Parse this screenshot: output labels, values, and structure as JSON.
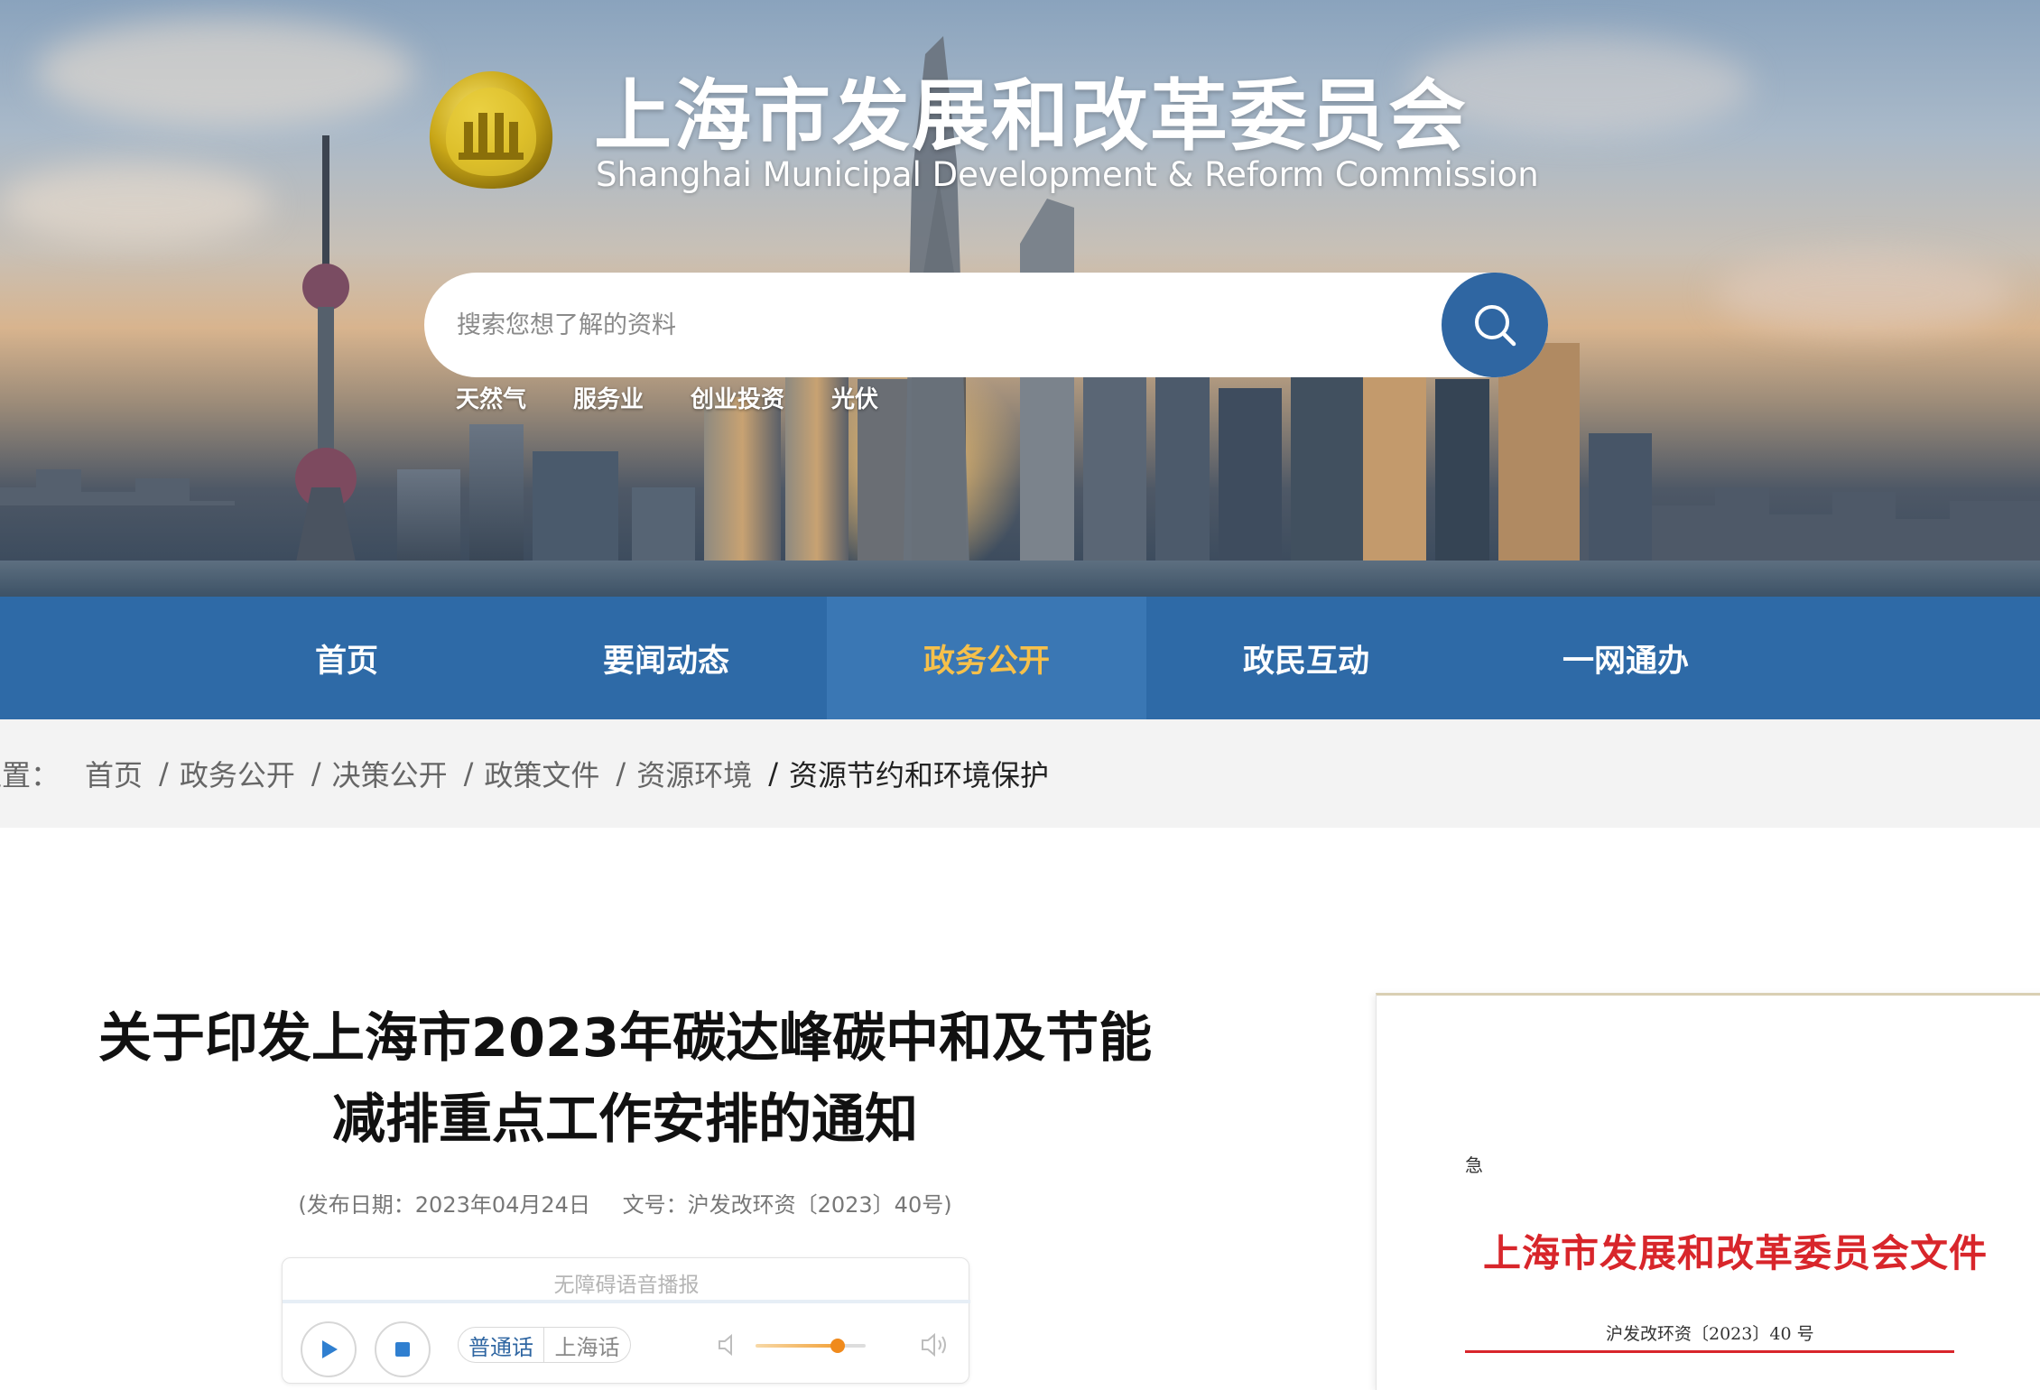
{
  "header": {
    "title_cn": "上海市发展和改革委员会",
    "title_en": "Shanghai Municipal Development & Reform Commission"
  },
  "search": {
    "placeholder": "搜索您想了解的资料",
    "hotwords": [
      "天然气",
      "服务业",
      "创业投资",
      "光伏"
    ]
  },
  "nav": {
    "items": [
      {
        "label": "首页"
      },
      {
        "label": "要闻动态"
      },
      {
        "label": "政务公开",
        "active": true
      },
      {
        "label": "政民互动"
      },
      {
        "label": "一网通办"
      }
    ]
  },
  "breadcrumb": {
    "lead": "位置：",
    "items": [
      "首页",
      "政务公开",
      "决策公开",
      "政策文件",
      "资源环境"
    ],
    "current": "资源节约和环境保护"
  },
  "article": {
    "title_line1": "关于印发上海市2023年碳达峰碳中和及节能",
    "title_line2": "减排重点工作安排的通知",
    "date": "(发布日期：2023年04月24日",
    "doc_no": "文号：沪发改环资〔2023〕40号)"
  },
  "player": {
    "title": "无障碍语音播报",
    "lang_a": "普通话",
    "lang_b": "上海话",
    "volume_level": 0.75
  },
  "doc_preview": {
    "urgent": "急",
    "header": "上海市发展和改革委员会文件",
    "number": "沪发改环资〔2023〕40 号"
  },
  "colors": {
    "nav_bg": "#2e6aa7",
    "nav_active_text": "#f6c04a",
    "search_button": "#2f66a2",
    "doc_red": "#d8262b"
  }
}
